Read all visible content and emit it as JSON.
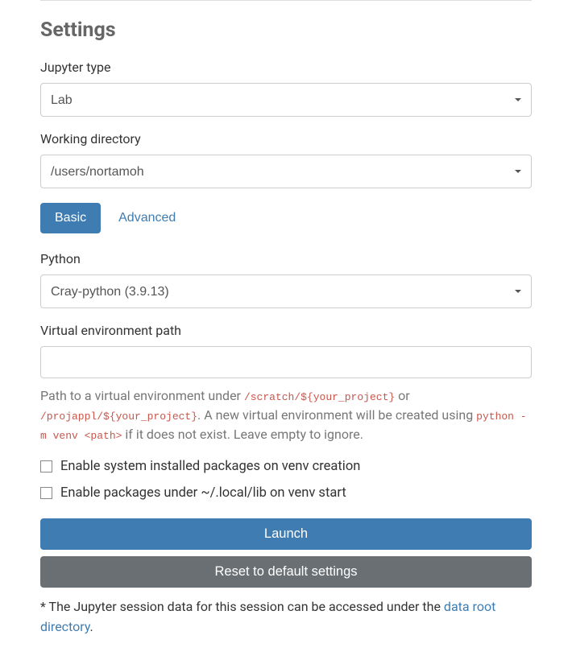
{
  "heading": "Settings",
  "jupyter_type": {
    "label": "Jupyter type",
    "value": "Lab"
  },
  "working_directory": {
    "label": "Working directory",
    "value": "/users/nortamoh"
  },
  "tabs": {
    "basic": "Basic",
    "advanced": "Advanced"
  },
  "python": {
    "label": "Python",
    "value": "Cray-python (3.9.13)"
  },
  "venv_path": {
    "label": "Virtual environment path",
    "value": "",
    "help_prefix": "Path to a virtual environment under ",
    "help_code1": "/scratch/${your_project}",
    "help_or": " or ",
    "help_code2": "/projappl/${your_project}",
    "help_mid": ". A new virtual environment will be created using ",
    "help_code3": "python -m venv <path>",
    "help_suffix": " if it does not exist. Leave empty to ignore."
  },
  "checkbox1": {
    "label": "Enable system installed packages on venv creation"
  },
  "checkbox2": {
    "label": "Enable packages under ~/.local/lib on venv start"
  },
  "buttons": {
    "launch": "Launch",
    "reset": "Reset to default settings"
  },
  "footnote": {
    "prefix": "* The Jupyter session data for this session can be accessed under the ",
    "link": "data root directory",
    "suffix": "."
  }
}
